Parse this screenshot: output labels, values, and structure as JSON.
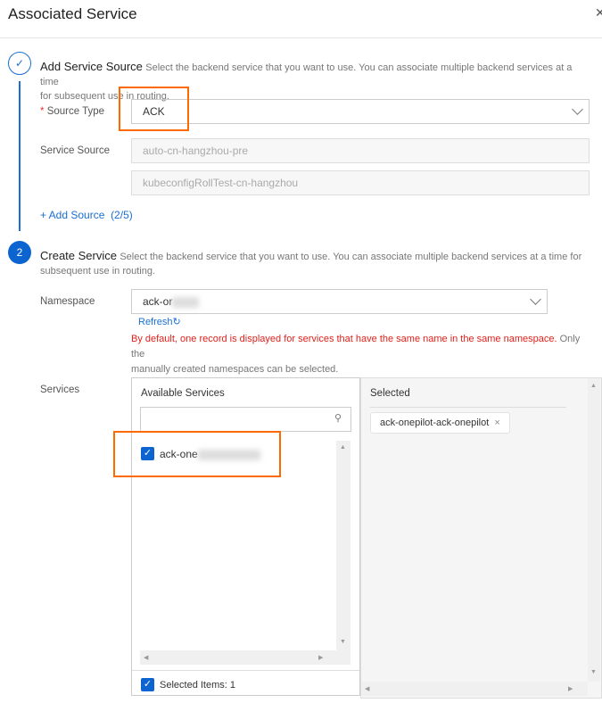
{
  "dialog": {
    "title": "Associated Service",
    "close_icon": "close-icon"
  },
  "step1": {
    "number": "✓",
    "title": "Add Service Source",
    "description": "Select the backend service that you want to use. You can associate multiple backend services at a time",
    "description_cont": "for subsequent use in routing.",
    "source_type_label": "Source Type",
    "required_mark": "*",
    "source_type_value": "ACK",
    "service_source_label": "Service Source",
    "service_sources": [
      "auto-cn-hangzhou-pre",
      "kubeconfigRollTest-cn-hangzhou"
    ],
    "add_source_label": "+ Add Source",
    "add_source_count": "(2/5)"
  },
  "step2": {
    "number": "2",
    "title": "Create Service",
    "description": "Select the backend service that you want to use. You can associate multiple backend services at a time for",
    "description_cont": "subsequent use in routing.",
    "namespace_label": "Namespace",
    "namespace_value": "ack-or",
    "refresh_label": "Refresh",
    "warning_red": "By default, one record is displayed for services that have the same name in the same namespace.",
    "warning_gray": " Only the",
    "warning_cont": "manually created namespaces can be selected.",
    "services_label": "Services",
    "available_title": "Available Services",
    "search_placeholder": "",
    "available_items": [
      {
        "label": "ack-one",
        "checked": true
      }
    ],
    "selected_count_label": "Selected Items: 1",
    "selected_title": "Selected",
    "selected_tags": [
      "ack-onepilot-ack-onepilot"
    ]
  },
  "colors": {
    "primary": "#0b64d0",
    "highlight": "#ff6a00",
    "warning": "#e0201c"
  }
}
